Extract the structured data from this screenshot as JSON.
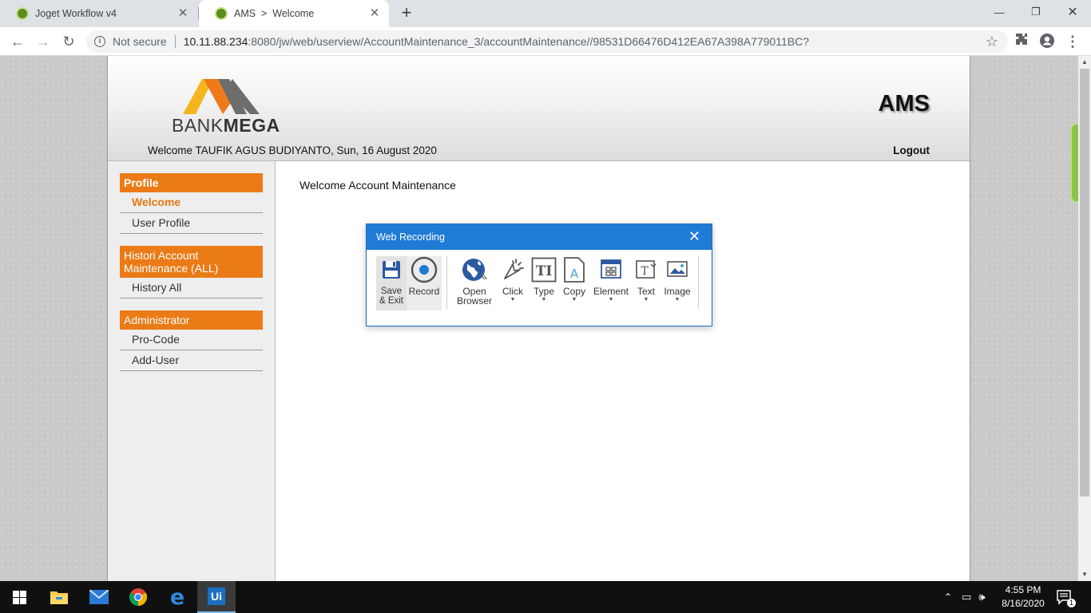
{
  "browser": {
    "tabs": [
      {
        "title": "Joget Workflow v4",
        "active": false
      },
      {
        "title": "AMS  >  Welcome",
        "active": true
      }
    ],
    "security_label": "Not secure",
    "url_host": "10.11.88.234",
    "url_rest": ":8080/jw/web/userview/AccountMaintenance_3/accountMaintenance//98531D66476D412EA67A398A779011BC?"
  },
  "page": {
    "logo": {
      "text_light": "BANK",
      "text_bold": "MEGA"
    },
    "app_title": "AMS",
    "welcome_line": "Welcome TAUFIK AGUS BUDIYANTO, Sun, 16 August 2020",
    "logout_label": "Logout",
    "content_text": "Welcome Account Maintenance",
    "sidebar": {
      "categories": [
        {
          "label": "Profile",
          "items": [
            "Welcome",
            "User Profile"
          ]
        },
        {
          "label": "Histori Account Maintenance (ALL)",
          "items": [
            "History All"
          ]
        },
        {
          "label": "Administrator",
          "items": [
            "Pro-Code",
            "Add-User"
          ]
        }
      ],
      "active_item": "Welcome"
    }
  },
  "dialog": {
    "title": "Web Recording",
    "tools": {
      "save": "Save\n& Exit",
      "record": "Record",
      "open_browser": "Open\nBrowser",
      "click": "Click",
      "type": "Type",
      "copy": "Copy",
      "element": "Element",
      "text": "Text",
      "image": "Image"
    }
  },
  "taskbar": {
    "clock_time": "4:55 PM",
    "clock_date": "8/16/2020",
    "notification_count": "1",
    "apps": [
      "file-explorer",
      "mail",
      "chrome",
      "edge",
      "uipath"
    ]
  },
  "colors": {
    "accent_orange": "#ea7b16",
    "dialog_blue": "#1f7bd6",
    "logo_yellow": "#f5b51c",
    "logo_orange": "#ef7a1a",
    "logo_gray": "#6d6d6d"
  }
}
